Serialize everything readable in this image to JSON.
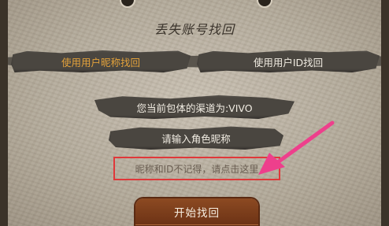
{
  "title": "丢失账号找回",
  "tabs": [
    {
      "label": "使用用户昵称找回",
      "active": true
    },
    {
      "label": "使用用户ID找回",
      "active": false
    }
  ],
  "channel_text": "您当前包体的渠道为:VIVO",
  "nickname_input": {
    "placeholder": "请输入角色昵称"
  },
  "forgot_link": "昵称和ID不记得，请点击这里",
  "start_button": "开始找回",
  "colors": {
    "active_tab_text": "#e3a23b",
    "highlight_box": "#e0383a",
    "arrow": "#ee3f8c",
    "start_button": "#7a3a1a"
  }
}
